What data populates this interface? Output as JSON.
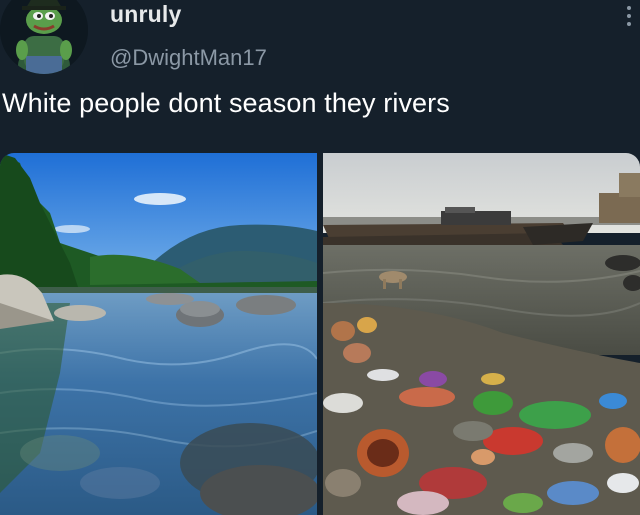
{
  "author": {
    "display_name": "unruly",
    "handle": "@DwightMan17",
    "avatar_icon": "frog-avatar-icon"
  },
  "tweet": {
    "text": "White people dont season they rivers"
  },
  "media": {
    "images": [
      "clean-river-photo",
      "polluted-river-photo"
    ]
  },
  "colors": {
    "background": "#15202b",
    "primary_text": "#e7e9ea",
    "secondary_text": "#8b98a5"
  }
}
